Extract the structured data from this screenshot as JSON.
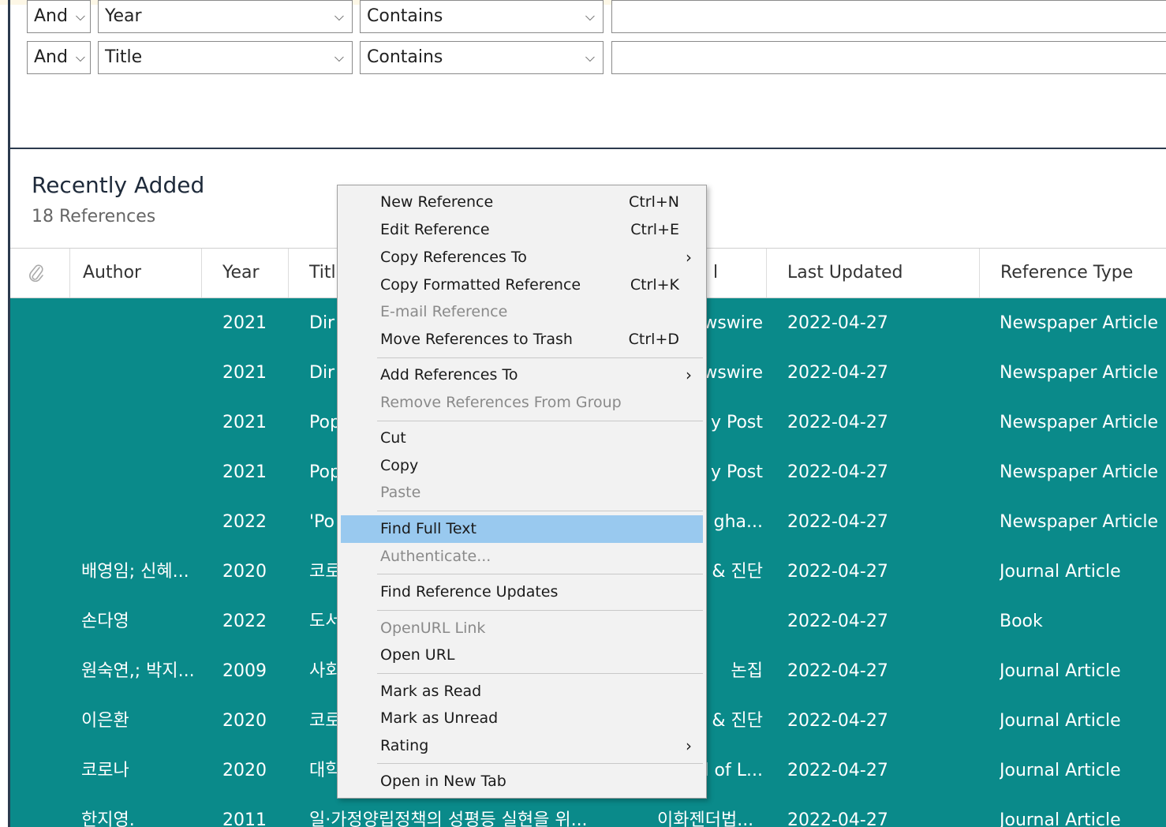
{
  "search": {
    "rows": [
      {
        "bool": "And",
        "field": "Year",
        "op": "Contains",
        "value": ""
      },
      {
        "bool": "And",
        "field": "Title",
        "op": "Contains",
        "value": ""
      }
    ]
  },
  "group": {
    "title": "Recently Added",
    "count": "18 References"
  },
  "table": {
    "columns": [
      "Author",
      "Year",
      "Title",
      "Journal",
      "Last Updated",
      "Reference Type"
    ],
    "visible_headers": {
      "author": "Author",
      "year": "Year",
      "title": "Titl",
      "journal": "l",
      "updated": "Last Updated",
      "type": "Reference Type"
    },
    "rows": [
      {
        "author": "",
        "year": "2021",
        "title": "Dir",
        "journal": "wswire",
        "updated": "2022-04-27",
        "type": "Newspaper Article"
      },
      {
        "author": "",
        "year": "2021",
        "title": "Dir",
        "journal": "wswire",
        "updated": "2022-04-27",
        "type": "Newspaper Article"
      },
      {
        "author": "",
        "year": "2021",
        "title": "Pop",
        "journal": "y Post",
        "updated": "2022-04-27",
        "type": "Newspaper Article"
      },
      {
        "author": "",
        "year": "2021",
        "title": "Pop",
        "journal": "y Post",
        "updated": "2022-04-27",
        "type": "Newspaper Article"
      },
      {
        "author": "",
        "year": "2022",
        "title": "'Po",
        "journal": "gha...",
        "updated": "2022-04-27",
        "type": "Newspaper Article"
      },
      {
        "author": "배영임; 신혜...",
        "year": "2020",
        "title": "코로",
        "journal": "& 진단",
        "updated": "2022-04-27",
        "type": "Journal Article"
      },
      {
        "author": "손다영",
        "year": "2022",
        "title": "도서",
        "journal": "",
        "updated": "2022-04-27",
        "type": "Book"
      },
      {
        "author": "원숙연,; 박지...",
        "year": "2009",
        "title": "사회",
        "journal": "논집",
        "updated": "2022-04-27",
        "type": "Journal Article"
      },
      {
        "author": "이은환",
        "year": "2020",
        "title": "코로",
        "journal": "& 진단",
        "updated": "2022-04-27",
        "type": "Journal Article"
      },
      {
        "author": "코로나",
        "year": "2020",
        "title": "대학",
        "journal": "l of L...",
        "updated": "2022-04-27",
        "type": "Journal Article"
      },
      {
        "author": "한지영.",
        "year": "2011",
        "title": "일·가정양립정책의 성평등 실현을 위...",
        "journal": "이화젠더법...",
        "updated": "2022-04-27",
        "type": "Journal Article"
      }
    ]
  },
  "context_menu": {
    "items": [
      {
        "label": "New Reference",
        "shortcut": "Ctrl+N",
        "submenu": false,
        "disabled": false
      },
      {
        "label": "Edit Reference",
        "shortcut": "Ctrl+E",
        "submenu": false,
        "disabled": false
      },
      {
        "label": "Copy References To",
        "shortcut": "",
        "submenu": true,
        "disabled": false
      },
      {
        "label": "Copy Formatted Reference",
        "shortcut": "Ctrl+K",
        "submenu": false,
        "disabled": false
      },
      {
        "label": "E-mail Reference",
        "shortcut": "",
        "submenu": false,
        "disabled": true
      },
      {
        "label": "Move References to Trash",
        "shortcut": "Ctrl+D",
        "submenu": false,
        "disabled": false
      },
      {
        "label": "Add References To",
        "shortcut": "",
        "submenu": true,
        "disabled": false
      },
      {
        "label": "Remove References From Group",
        "shortcut": "",
        "submenu": false,
        "disabled": true
      },
      {
        "label": "Cut",
        "shortcut": "",
        "submenu": false,
        "disabled": false
      },
      {
        "label": "Copy",
        "shortcut": "",
        "submenu": false,
        "disabled": false
      },
      {
        "label": "Paste",
        "shortcut": "",
        "submenu": false,
        "disabled": true
      },
      {
        "label": "Find Full Text",
        "shortcut": "",
        "submenu": false,
        "disabled": false,
        "highlighted": true
      },
      {
        "label": "Authenticate...",
        "shortcut": "",
        "submenu": false,
        "disabled": true
      },
      {
        "label": "Find Reference Updates",
        "shortcut": "",
        "submenu": false,
        "disabled": false
      },
      {
        "label": "OpenURL Link",
        "shortcut": "",
        "submenu": false,
        "disabled": true
      },
      {
        "label": "Open URL",
        "shortcut": "",
        "submenu": false,
        "disabled": false
      },
      {
        "label": "Mark as Read",
        "shortcut": "",
        "submenu": false,
        "disabled": false
      },
      {
        "label": "Mark as Unread",
        "shortcut": "",
        "submenu": false,
        "disabled": false
      },
      {
        "label": "Rating",
        "shortcut": "",
        "submenu": true,
        "disabled": false
      },
      {
        "label": "Open in New Tab",
        "shortcut": "",
        "submenu": false,
        "disabled": false
      }
    ]
  },
  "icons": {
    "attachment": "paperclip-icon",
    "dropdown": "chevron-down-icon",
    "submenu": "chevron-right-icon"
  },
  "colors": {
    "selection": "#0a8a8a",
    "menu_highlight": "#99c9ef",
    "menu_bg": "#f2f2f2",
    "disabled_text": "#8a8a8a"
  }
}
